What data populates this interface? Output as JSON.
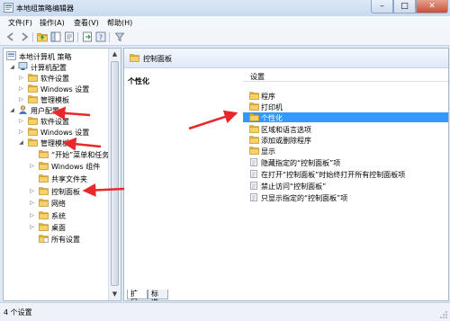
{
  "window": {
    "title": "本地组策略编辑器"
  },
  "menu": [
    "文件(F)",
    "操作(A)",
    "查看(V)",
    "帮助(H)"
  ],
  "tree": {
    "root": "本地计算机 策略",
    "computer_config": "计算机配置",
    "cc_software": "软件设置",
    "cc_windows": "Windows 设置",
    "cc_admin": "管理模板",
    "user_config": "用户配置",
    "uc_software": "软件设置",
    "uc_windows": "Windows 设置",
    "uc_admin": "管理模板",
    "start_menu": "“开始”菜单和任务栏",
    "win_components": "Windows 组件",
    "shared_folders": "共享文件夹",
    "control_panel": "控制面板",
    "network": "网络",
    "system": "系统",
    "desktop": "桌面",
    "all_settings": "所有设置"
  },
  "right": {
    "header": "控制面板",
    "selected_title": "个性化",
    "column": "设置",
    "items": [
      {
        "type": "folder",
        "label": "程序"
      },
      {
        "type": "folder",
        "label": "打印机"
      },
      {
        "type": "folder",
        "label": "个性化",
        "selected": true
      },
      {
        "type": "folder",
        "label": "区域和语言选项"
      },
      {
        "type": "folder",
        "label": "添加或删除程序"
      },
      {
        "type": "folder",
        "label": "显示"
      },
      {
        "type": "setting",
        "label": "隐藏指定的“控制面板”项"
      },
      {
        "type": "setting",
        "label": "在打开“控制面板”时始终打开所有控制面板项"
      },
      {
        "type": "setting",
        "label": "禁止访问“控制面板”"
      },
      {
        "type": "setting",
        "label": "只显示指定的“控制面板”项"
      }
    ],
    "tabs": [
      "扩展",
      "标准"
    ]
  },
  "status": {
    "text": "4 个设置"
  },
  "colors": {
    "accent": "#3399ff",
    "annotation": "#e8282a",
    "folder": "#f2c24e"
  }
}
